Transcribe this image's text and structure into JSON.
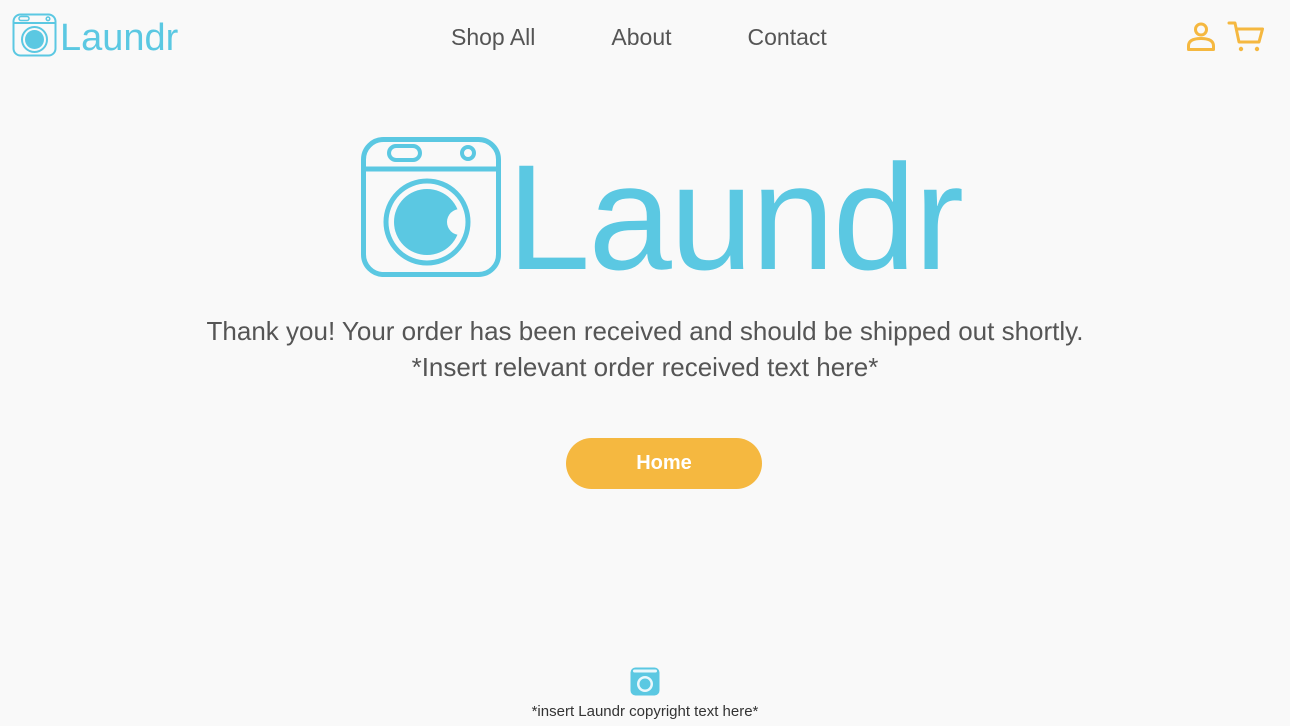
{
  "brand": {
    "name": "Laundr",
    "logo_icon": "washing-machine-icon"
  },
  "nav": {
    "items": [
      {
        "label": "Shop All"
      },
      {
        "label": "About"
      },
      {
        "label": "Contact"
      }
    ]
  },
  "header_icons": {
    "account": "user-icon",
    "cart": "cart-icon"
  },
  "hero": {
    "logo_text": "Laundr",
    "message_line1": "Thank you! Your order has been received and should be shipped out shortly.",
    "message_line2": "*Insert relevant order received text here*"
  },
  "home_button": {
    "label": "Home"
  },
  "footer": {
    "logo_icon": "washing-machine-icon",
    "copyright": "*insert Laundr copyright text here*"
  },
  "colors": {
    "brand_blue": "#5bc8e2",
    "accent_yellow": "#f5b840",
    "text_gray": "#555555",
    "background": "#f9f9f9"
  }
}
